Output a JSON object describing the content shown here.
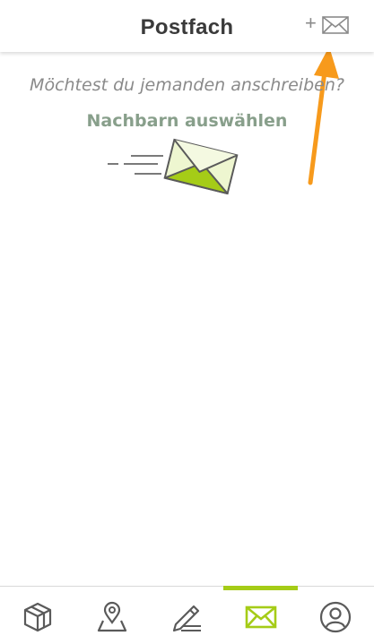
{
  "header": {
    "title": "Postfach",
    "compose_plus": "+",
    "compose_icon": "mail-plus-icon"
  },
  "main": {
    "prompt": "Möchtest du jemanden anschreiben?",
    "select_link": "Nachbarn auswählen",
    "illustration_icon": "flying-envelope-icon"
  },
  "tabs": [
    {
      "icon": "cube-icon",
      "active": false
    },
    {
      "icon": "map-pin-icon",
      "active": false
    },
    {
      "icon": "pencil-icon",
      "active": false
    },
    {
      "icon": "mail-icon",
      "active": true
    },
    {
      "icon": "user-icon",
      "active": false
    }
  ],
  "colors": {
    "accent": "#a5cc17",
    "arrow": "#f79a1c",
    "link": "#889f8b",
    "text_muted": "#8a8a8a"
  }
}
